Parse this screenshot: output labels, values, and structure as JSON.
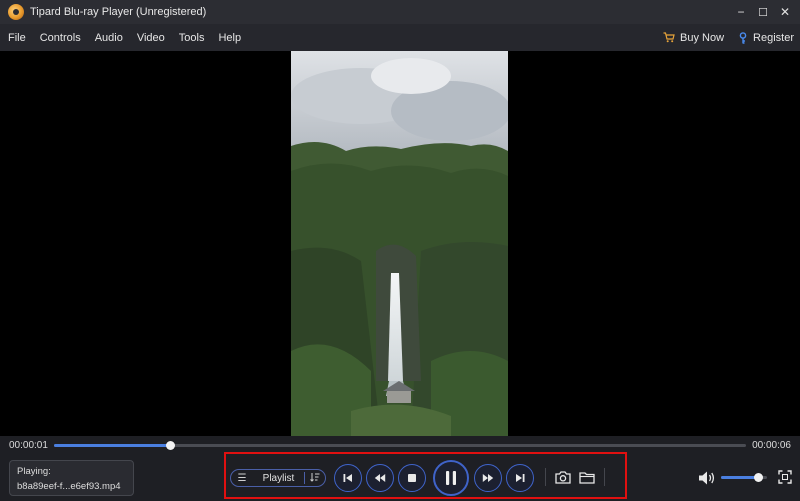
{
  "window": {
    "title": "Tipard Blu-ray Player (Unregistered)",
    "minimize_glyph": "−",
    "maximize_glyph": "☐",
    "close_glyph": "✕"
  },
  "menu": {
    "items": [
      "File",
      "Controls",
      "Audio",
      "Video",
      "Tools",
      "Help"
    ],
    "buy_now": "Buy Now",
    "register": "Register"
  },
  "playback": {
    "current_time": "00:00:01",
    "total_time": "00:00:06",
    "progress_fraction": 0.167,
    "volume_fraction": 0.8
  },
  "now_playing": {
    "label": "Playing:",
    "filename": "b8a89eef-f...e6ef93.mp4"
  },
  "controls": {
    "playlist_label": "Playlist",
    "playlist_icon": "list-icon",
    "sort_icon": "sort-icon",
    "buttons": [
      "previous-icon",
      "rewind-icon",
      "stop-icon",
      "pause-icon",
      "fast-forward-icon",
      "next-icon"
    ],
    "tools": [
      "camera-icon",
      "folder-icon"
    ],
    "accent_color": "#3f63c9",
    "highlight_color": "#e01010"
  }
}
